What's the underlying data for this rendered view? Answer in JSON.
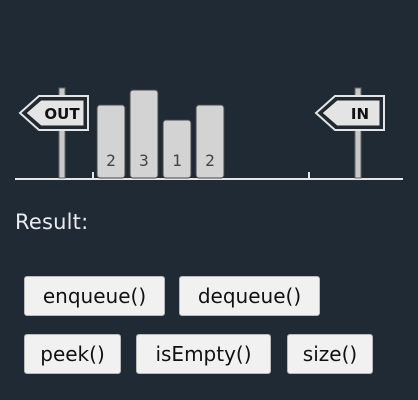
{
  "signs": {
    "out_label": "OUT",
    "in_label": "IN"
  },
  "queue": {
    "items": [
      "2",
      "3",
      "1",
      "2"
    ]
  },
  "result": {
    "label": "Result:"
  },
  "buttons": {
    "enqueue": "enqueue()",
    "dequeue": "dequeue()",
    "peek": "peek()",
    "isEmpty": "isEmpty()",
    "size": "size()"
  },
  "colors": {
    "background": "#1f2a35",
    "item_fill": "#d3d3d3",
    "sign_fill": "#e4e4e4",
    "post": "#c8c8c8"
  }
}
